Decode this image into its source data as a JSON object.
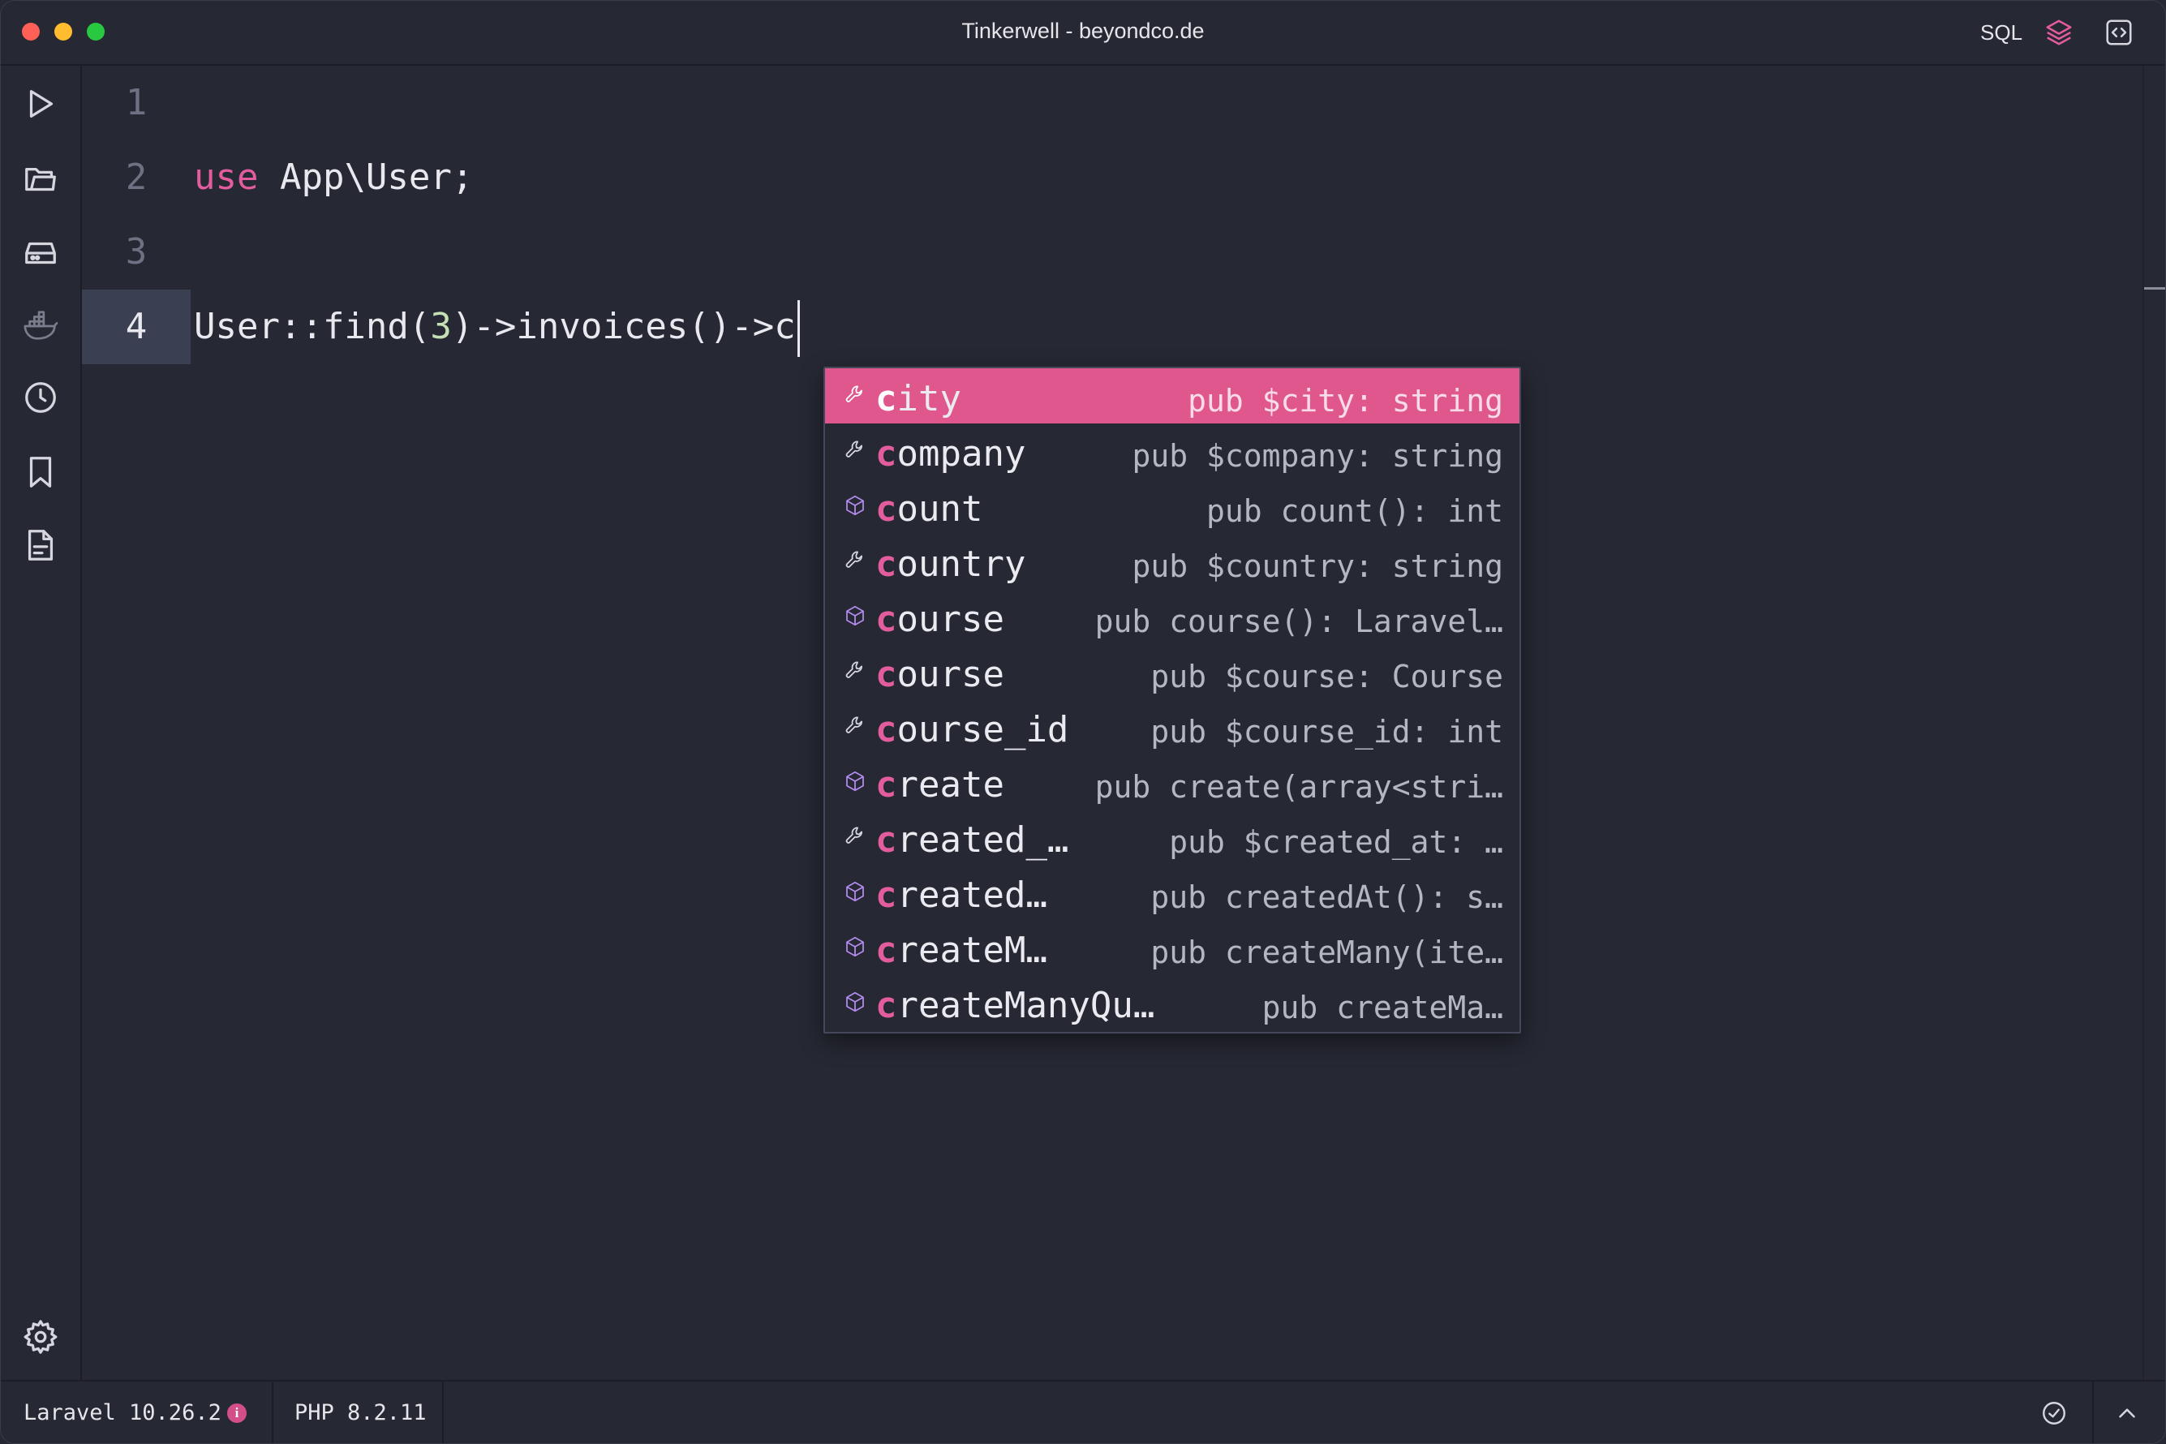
{
  "window": {
    "title": "Tinkerwell - beyondco.de",
    "sql_label": "SQL"
  },
  "sidebar": {
    "icons": [
      "run-icon",
      "folder-icon",
      "database-icon",
      "docker-icon",
      "history-icon",
      "bookmark-icon",
      "snippet-file-icon",
      "settings-icon"
    ]
  },
  "editor": {
    "line_numbers": [
      "1",
      "2",
      "3",
      "4"
    ],
    "line2": {
      "keyword": "use",
      "rest": " App\\User;"
    },
    "line4": {
      "before": "User::find(",
      "number": "3",
      "after": ")->invoices()->c"
    },
    "active_line": "4"
  },
  "autocomplete": {
    "typed_prefix": "c",
    "selected_index": 0,
    "items": [
      {
        "kind": "property",
        "icon": "wrench-icon",
        "rest": "ity",
        "detail": "pub $city: string"
      },
      {
        "kind": "property",
        "icon": "wrench-icon",
        "rest": "ompany",
        "detail": "pub $company: string"
      },
      {
        "kind": "method",
        "icon": "cube-icon",
        "rest": "ount",
        "detail": "pub count(): int"
      },
      {
        "kind": "property",
        "icon": "wrench-icon",
        "rest": "ountry",
        "detail": "pub $country: string"
      },
      {
        "kind": "method",
        "icon": "cube-icon",
        "rest": "ourse",
        "detail": "pub course(): Laravel…"
      },
      {
        "kind": "property",
        "icon": "wrench-icon",
        "rest": "ourse",
        "detail": "pub $course: Course"
      },
      {
        "kind": "property",
        "icon": "wrench-icon",
        "rest": "ourse_id",
        "detail": "pub $course_id: int"
      },
      {
        "kind": "method",
        "icon": "cube-icon",
        "rest": "reate",
        "detail": "pub create(array<stri…"
      },
      {
        "kind": "property",
        "icon": "wrench-icon",
        "rest": "reated_…",
        "detail": "pub $created_at: …"
      },
      {
        "kind": "method",
        "icon": "cube-icon",
        "rest": "reated…",
        "detail": "pub createdAt(): s…"
      },
      {
        "kind": "method",
        "icon": "cube-icon",
        "rest": "reateM…",
        "detail": "pub createMany(ite…"
      },
      {
        "kind": "method",
        "icon": "cube-icon",
        "rest": "reateManyQu…",
        "detail": "pub createMa…"
      }
    ]
  },
  "statusbar": {
    "laravel_version": "Laravel 10.26.2",
    "info_glyph": "i",
    "php_version": "PHP 8.2.11"
  },
  "colors": {
    "background": "#262833",
    "accent": "#e0578e",
    "keyword": "#e35c9e",
    "method_icon": "#a78bfa"
  }
}
